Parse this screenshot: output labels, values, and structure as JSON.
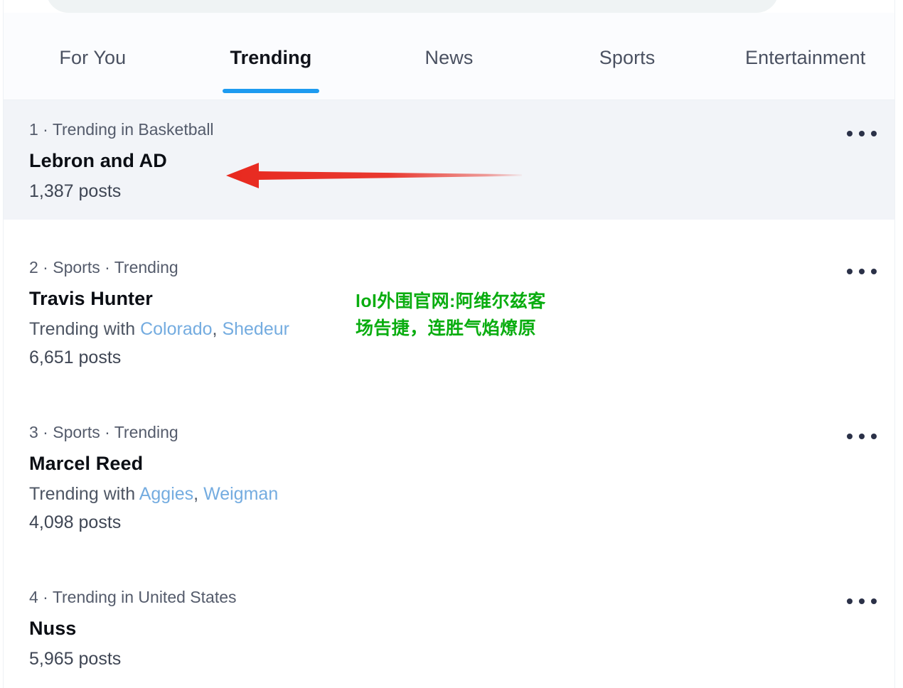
{
  "colors": {
    "accent": "#1D9BF0",
    "highlight_row_bg": "#F2F4F8",
    "link": "#74ACE0",
    "watermark_green": "#0AAD10",
    "annotation_red": "#E8291F",
    "page_bg": "#FFFFFF"
  },
  "search": {
    "placeholder": "",
    "value": ""
  },
  "tabs": [
    {
      "label": "For You",
      "active": false
    },
    {
      "label": "Trending",
      "active": true
    },
    {
      "label": "News",
      "active": false
    },
    {
      "label": "Sports",
      "active": false
    },
    {
      "label": "Entertainment",
      "active": false
    }
  ],
  "trends": [
    {
      "rank": "1",
      "meta": "1 · Trending in Basketball",
      "title": "Lebron and AD",
      "with_prefix": "",
      "with_links": [],
      "posts": "1,387 posts",
      "highlighted": true,
      "more_label": "More"
    },
    {
      "rank": "2",
      "meta": "2 · Sports · Trending",
      "title": "Travis Hunter",
      "with_prefix": "Trending with ",
      "with_links": [
        "Colorado",
        "Shedeur"
      ],
      "posts": "6,651 posts",
      "highlighted": false,
      "more_label": "More"
    },
    {
      "rank": "3",
      "meta": "3 · Sports · Trending",
      "title": "Marcel Reed",
      "with_prefix": "Trending with ",
      "with_links": [
        "Aggies",
        "Weigman"
      ],
      "posts": "4,098 posts",
      "highlighted": false,
      "more_label": "More"
    },
    {
      "rank": "4",
      "meta": "4 · Trending in United States",
      "title": "Nuss",
      "with_prefix": "",
      "with_links": [],
      "posts": "5,965 posts",
      "highlighted": false,
      "more_label": "More"
    }
  ],
  "annotations": {
    "arrow": {
      "direction": "left",
      "target": "Lebron and AD"
    },
    "watermark": {
      "text": "lol外围官网:阿维尔兹客场告捷，连胜气焰燎原"
    }
  }
}
